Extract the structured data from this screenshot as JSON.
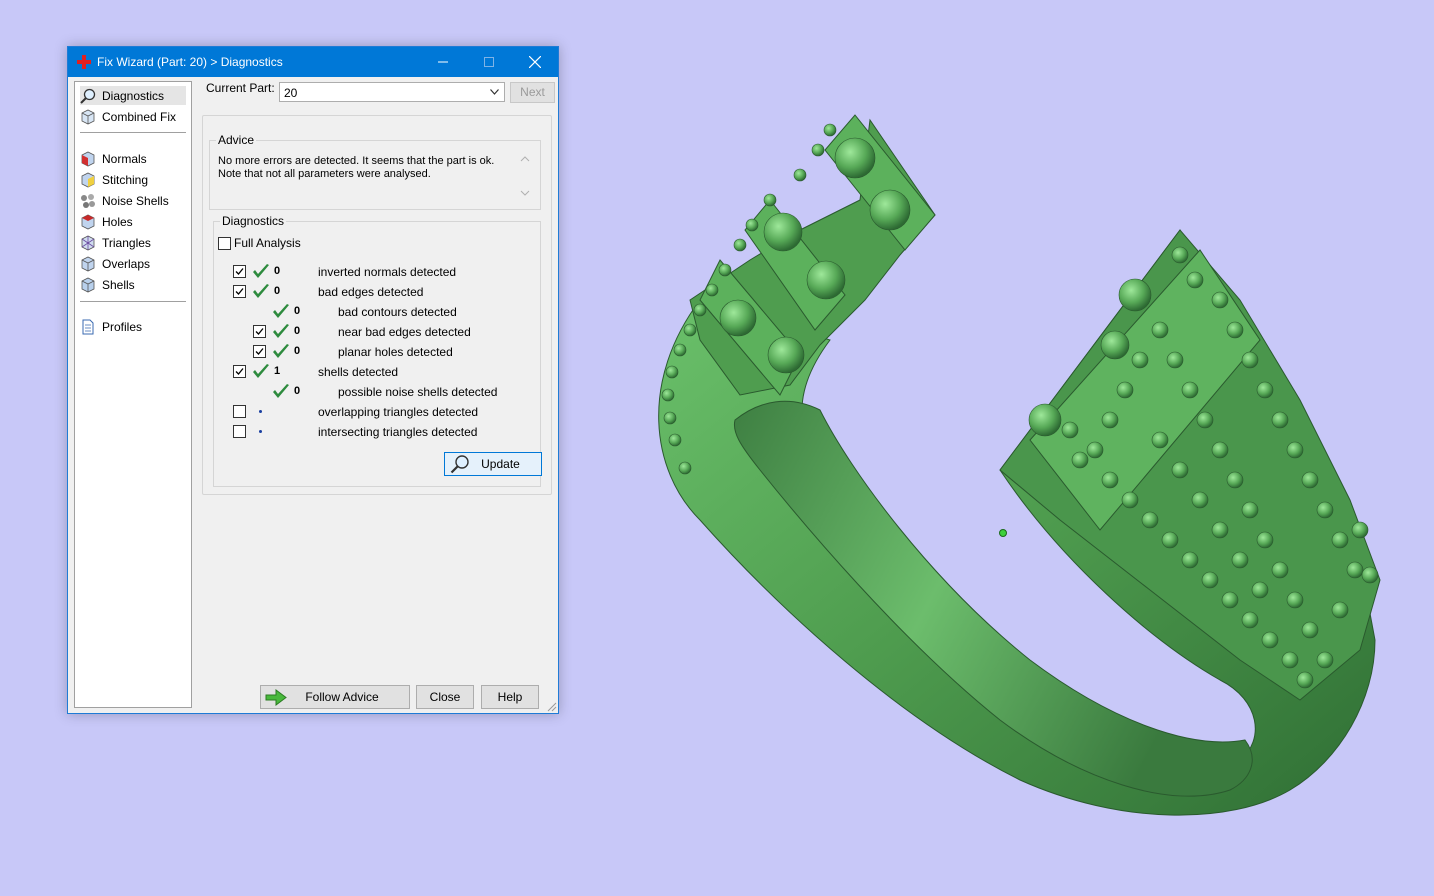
{
  "window": {
    "title": "Fix Wizard (Part: 20) > Diagnostics",
    "accent_color": "#0078d7"
  },
  "titlebar_buttons": [
    "minimize-icon",
    "maximize-icon",
    "close-icon"
  ],
  "sidebar": {
    "groups": [
      [
        {
          "label": "Diagnostics",
          "icon": "magnifier-icon",
          "selected": true
        },
        {
          "label": "Combined Fix",
          "icon": "cube-icon"
        }
      ],
      [
        {
          "label": "Normals",
          "icon": "normals-cube-icon"
        },
        {
          "label": "Stitching",
          "icon": "stitching-cube-icon"
        },
        {
          "label": "Noise Shells",
          "icon": "noise-shells-icon"
        },
        {
          "label": "Holes",
          "icon": "holes-cube-icon"
        },
        {
          "label": "Triangles",
          "icon": "triangles-cube-icon"
        },
        {
          "label": "Overlaps",
          "icon": "overlaps-cube-icon"
        },
        {
          "label": "Shells",
          "icon": "shells-cube-icon"
        }
      ],
      [
        {
          "label": "Profiles",
          "icon": "document-icon"
        }
      ]
    ]
  },
  "current_part": {
    "label": "Current Part:",
    "value": "20",
    "next_label": "Next"
  },
  "advice": {
    "title": "Advice",
    "lines": [
      "No more errors are detected. It seems that the part is ok.",
      "Note that not all parameters were analysed."
    ]
  },
  "diagnostics": {
    "title": "Diagnostics",
    "full_analysis_label": "Full Analysis",
    "full_analysis_checked": false,
    "rows": [
      {
        "count": "0",
        "label": "inverted normals detected",
        "checked": true,
        "has_checkbox": true,
        "status": "ok",
        "indent": 0
      },
      {
        "count": "0",
        "label": "bad edges detected",
        "checked": true,
        "has_checkbox": true,
        "status": "ok",
        "indent": 0
      },
      {
        "count": "0",
        "label": "bad contours detected",
        "checked": false,
        "has_checkbox": false,
        "status": "ok",
        "indent": 1
      },
      {
        "count": "0",
        "label": "near bad edges detected",
        "checked": true,
        "has_checkbox": true,
        "status": "ok",
        "indent": 1
      },
      {
        "count": "0",
        "label": "planar holes detected",
        "checked": true,
        "has_checkbox": true,
        "status": "ok",
        "indent": 1
      },
      {
        "count": "1",
        "label": "shells detected",
        "checked": true,
        "has_checkbox": true,
        "status": "ok",
        "indent": 0
      },
      {
        "count": "0",
        "label": "possible noise shells detected",
        "checked": false,
        "has_checkbox": false,
        "status": "ok",
        "indent": 1
      },
      {
        "count": "",
        "label": "overlapping triangles detected",
        "checked": false,
        "has_checkbox": true,
        "status": "pending",
        "indent": 0
      },
      {
        "count": "",
        "label": "intersecting triangles detected",
        "checked": false,
        "has_checkbox": true,
        "status": "pending",
        "indent": 0
      }
    ],
    "update_label": "Update"
  },
  "footer": {
    "follow_advice_label": "Follow Advice",
    "close_label": "Close",
    "help_label": "Help"
  },
  "colors": {
    "background": "#c8c8f8",
    "model_green": "#5aa75a",
    "check_green": "#2e8b3e"
  }
}
